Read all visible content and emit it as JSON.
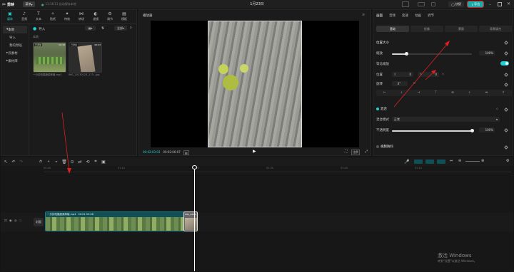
{
  "titlebar": {
    "app_name": "剪映",
    "menu_label": "菜单",
    "status_text": "11:16:11 自动保存本地",
    "project_title": "1月23日",
    "shortcut_label": "快捷",
    "export_label": "导出"
  },
  "media_tabs": [
    {
      "icon": "▣",
      "label": "媒体"
    },
    {
      "icon": "♪",
      "label": "音频"
    },
    {
      "icon": "T",
      "label": "文本"
    },
    {
      "icon": "✧",
      "label": "贴纸"
    },
    {
      "icon": "✦",
      "label": "特效"
    },
    {
      "icon": "⋈",
      "label": "转场"
    },
    {
      "icon": "◐",
      "label": "滤镜"
    },
    {
      "icon": "⚙",
      "label": "调节"
    },
    {
      "icon": "▤",
      "label": "模板"
    }
  ],
  "media_sidebar": [
    "本地",
    "导入",
    "我的预设",
    "云素材",
    "素材库"
  ],
  "media_toolbar": {
    "import_label": "导入",
    "sort_label": "全部"
  },
  "media_section_label": "本地",
  "media_items": [
    {
      "name": "一分钟拍摄蔬菜种植.mp4",
      "badge": "已添加",
      "duration": "00:18"
    },
    {
      "name": "IMG_20230123_173...jpg",
      "badge": "已添加",
      "duration": "00:03"
    }
  ],
  "player": {
    "title": "播放器",
    "current_time": "00:02:03:03",
    "total_time": "00:02:06:07",
    "ratio_label": "比例"
  },
  "inspector": {
    "tabs": [
      "画面",
      "音频",
      "变速",
      "动画",
      "调节"
    ],
    "segments": [
      "基础",
      "抠像",
      "蒙版",
      "背景填充"
    ],
    "position_size_label": "位置大小",
    "scale_label": "缩放",
    "scale_value": "100%",
    "scale_fraction": 0.18,
    "uniform_scale_label": "等比缩放",
    "position_label": "位置",
    "pos_x_label": "X",
    "pos_x_value": "0",
    "pos_y_label": "Y",
    "pos_y_value": "0",
    "rotate_label": "旋转",
    "rotate_value": "0°",
    "blend_label": "混合",
    "blend_mode_label": "混合模式",
    "blend_mode_value": "正常",
    "opacity_label": "不透明度",
    "opacity_value": "100%",
    "opacity_fraction": 1.0,
    "stabilize_label": "视频防抖"
  },
  "timeline": {
    "ruler_ticks": [
      "00:00",
      "01:10",
      "01:20",
      "01:30",
      "02:00",
      "02:10"
    ],
    "track_label": "封面",
    "clip1_name": "一分钟拍摄蔬菜种植.mp4",
    "clip1_duration": "00:01:55:08",
    "clip2_name": "IMG_2023..."
  },
  "watermark": {
    "line1": "激活 Windows",
    "line2": "转到\"设置\"以激活 Windows。"
  },
  "colors": {
    "accent": "#1fd1d1",
    "export_btn": "#1aa8a8",
    "annotation_red": "#e02020"
  }
}
